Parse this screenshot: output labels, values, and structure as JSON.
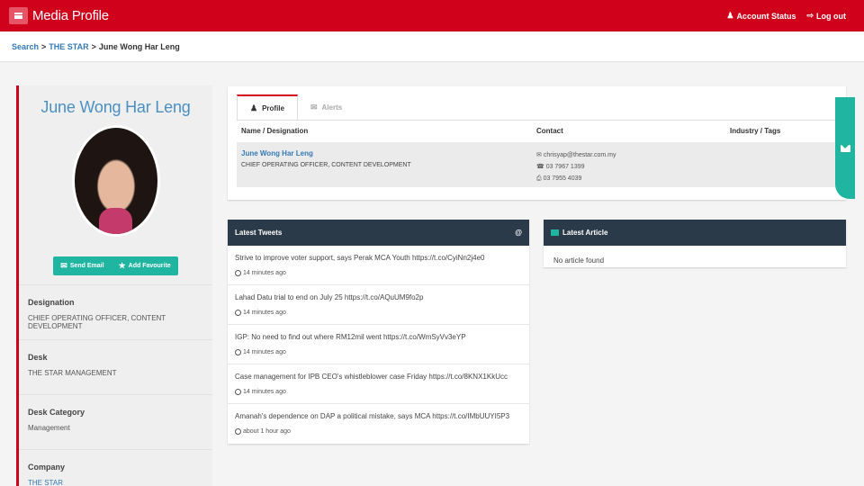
{
  "app": {
    "title": "Media Profile"
  },
  "topbar": {
    "account_status": "Account Status",
    "logout": "Log out"
  },
  "breadcrumb": {
    "search": "Search",
    "outlet": "THE STAR",
    "current": "June Wong Har Leng",
    "sep": ">"
  },
  "profile": {
    "name": "June Wong Har Leng",
    "send_email": "Send Email",
    "add_favourite": "Add Favourite",
    "fields": [
      {
        "label": "Designation",
        "value": "CHIEF OPERATING OFFICER, CONTENT DEVELOPMENT"
      },
      {
        "label": "Desk",
        "value": "THE STAR MANAGEMENT"
      },
      {
        "label": "Desk Category",
        "value": "Management"
      },
      {
        "label": "Company",
        "value": "THE STAR"
      }
    ]
  },
  "tabs": [
    {
      "label": "Profile"
    },
    {
      "label": "Alerts"
    }
  ],
  "table": {
    "headers": [
      "Name / Designation",
      "Contact",
      "Industry / Tags"
    ],
    "row": {
      "name": "June Wong Har Leng",
      "designation": "CHIEF OPERATING OFFICER, CONTENT DEVELOPMENT",
      "email": "chrisyap@thestar.com.my",
      "phone": "03 7967 1399",
      "fax": "03 7955 4039"
    }
  },
  "tweets": {
    "title": "Latest Tweets",
    "at_symbol": "@",
    "items": [
      {
        "text": "Strive to improve voter support, says Perak MCA Youth https://t.co/CyiNn2j4e0",
        "time": "14 minutes ago"
      },
      {
        "text": "Lahad Datu trial to end on July 25 https://t.co/AQuUM9fo2p",
        "time": "14 minutes ago"
      },
      {
        "text": "IGP: No need to find out where RM12mil went https://t.co/WmSyVv3eYP",
        "time": "14 minutes ago"
      },
      {
        "text": "Case management for IPB CEO's whistleblower case Friday https://t.co/8KNX1KkUcc",
        "time": "14 minutes ago"
      },
      {
        "text": "Amanah's dependence on DAP a political mistake, says MCA https://t.co/IMbUUYI5P3",
        "time": "about 1 hour ago"
      }
    ]
  },
  "article": {
    "title": "Latest Article",
    "empty": "No article found"
  },
  "colors": {
    "brand_red": "#d0021b",
    "teal": "#1fb5a0",
    "navy": "#2b3a48",
    "link": "#337ab7"
  }
}
